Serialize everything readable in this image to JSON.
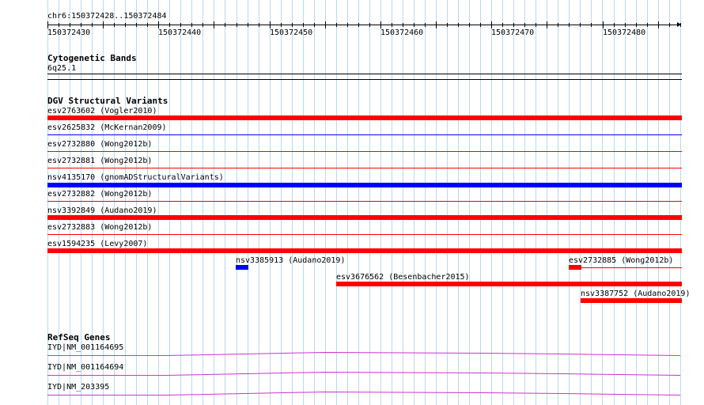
{
  "ruler": {
    "location": "chr6:150372428..150372484",
    "ticks": [
      "150372430",
      "150372440",
      "150372450",
      "150372460",
      "150372470",
      "150372480"
    ]
  },
  "cytoband": {
    "title": "Cytogenetic Bands",
    "band": "6q25.1"
  },
  "dgv": {
    "title": "DGV Structural Variants",
    "rows": [
      {
        "label": "esv2763602 (Vogler2010)",
        "color": "#ff0000",
        "kind": "loss"
      },
      {
        "label": "esv2625832 (McKernan2009)",
        "color": "#0000ff",
        "kind": "gain"
      },
      {
        "label": "esv2732880 (Wong2012b)",
        "color": "#ff0000",
        "kind": "loss"
      },
      {
        "label": "esv2732881 (Wong2012b)",
        "color": "#ff0000",
        "kind": "loss"
      },
      {
        "label": "nsv4135170 (gnomADStructuralVariants)",
        "color": "#0000ff",
        "kind": "gain"
      },
      {
        "label": "esv2732882 (Wong2012b)",
        "color": "#ff0000",
        "kind": "loss"
      },
      {
        "label": "nsv3392849 (Audano2019)",
        "color": "#ff0000",
        "kind": "loss"
      },
      {
        "label": "esv2732883 (Wong2012b)",
        "color": "#ff0000",
        "kind": "loss"
      },
      {
        "label": "esv1594235 (Levy2007)",
        "color": "#ff0000",
        "kind": "loss"
      }
    ],
    "partials": [
      {
        "label": "nsv3385913 (Audano2019)",
        "color": "#0000ff"
      },
      {
        "label": "esv2732885 (Wong2012b)",
        "color": "#ff0000"
      },
      {
        "label": "esv3676562 (Besenbacher2015)",
        "color": "#ff0000"
      },
      {
        "label": "nsv3387752 (Audano2019)",
        "color": "#ff0000"
      }
    ]
  },
  "refseq": {
    "title": "RefSeq Genes",
    "transcripts": [
      {
        "label": "IYD|NM_001164695",
        "color": "#cc33cc"
      },
      {
        "label": "IYD|NM_001164694",
        "color": "#cc33cc"
      },
      {
        "label": "IYD|NM_203395",
        "color": "#cc33cc"
      }
    ]
  },
  "colors": {
    "grid": "#bcd8ee",
    "loss": "#ff0000",
    "gain": "#0000ff",
    "gene": "#cc33cc"
  }
}
